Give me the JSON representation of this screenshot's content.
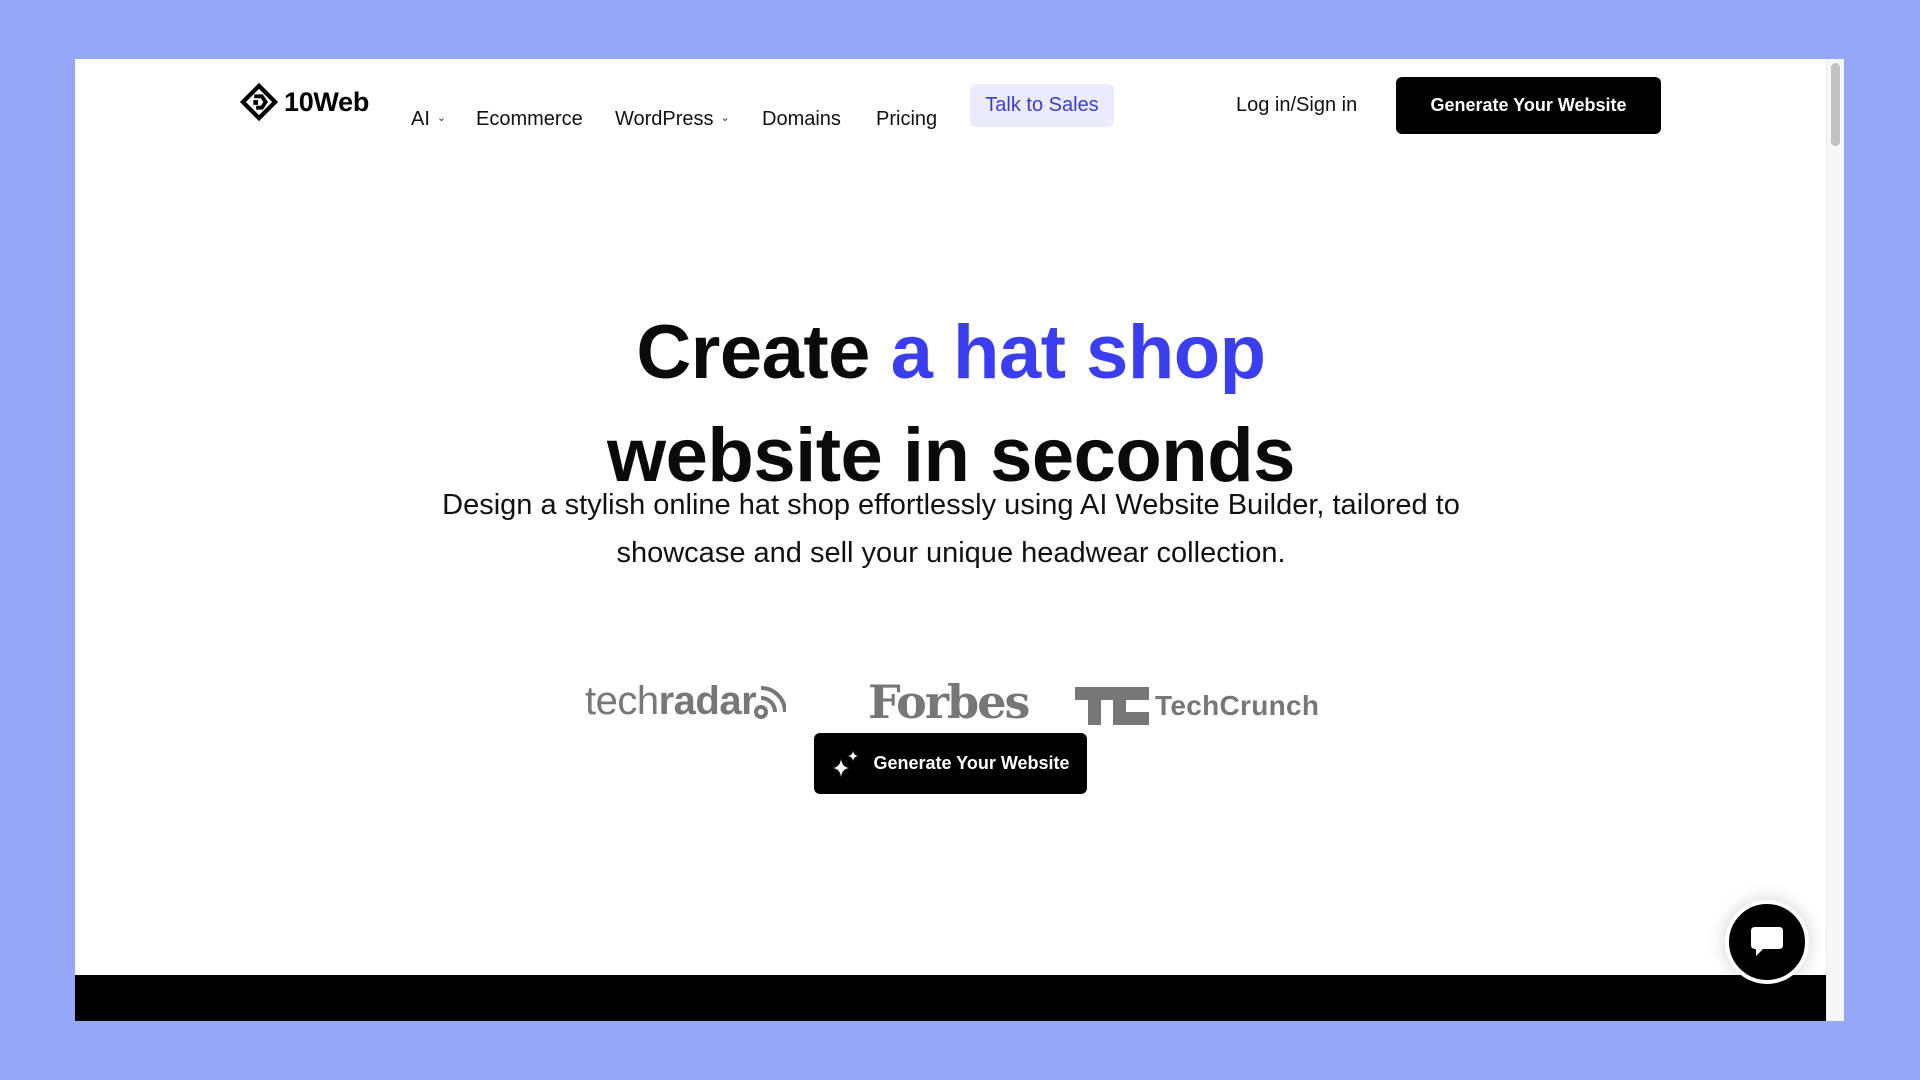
{
  "brand": {
    "name": "10Web",
    "logo_icon": "10web-diamond-logo-icon"
  },
  "nav": {
    "items": [
      {
        "label": "AI",
        "has_dropdown": true
      },
      {
        "label": "Ecommerce",
        "has_dropdown": false
      },
      {
        "label": "WordPress",
        "has_dropdown": true
      },
      {
        "label": "Domains",
        "has_dropdown": false
      },
      {
        "label": "Pricing",
        "has_dropdown": false
      }
    ],
    "dropdown_icon": "chevron-down-icon",
    "talk_to_sales": "Talk to Sales",
    "login": "Log in/Sign in",
    "cta": "Generate Your Website"
  },
  "hero": {
    "title_prefix": "Create ",
    "title_accent": "a hat shop",
    "title_line2": "website in seconds",
    "subtitle": "Design a stylish online hat shop effortlessly using AI Website Builder, tailored to showcase and sell your unique headwear collection.",
    "cta": "Generate Your Website",
    "cta_icon": "sparkles-icon"
  },
  "press_logos": {
    "techradar_light": "tech",
    "techradar_bold": "radar",
    "forbes": "Forbes",
    "techcrunch": "TechCrunch"
  },
  "chat": {
    "icon": "chat-bubble-icon"
  },
  "colors": {
    "accent": "#3b3ef0",
    "talk_bg": "#ebebfd",
    "talk_text": "#3b3bd6",
    "page_bg": "#95a8f8",
    "logo_gray": "#777777"
  }
}
